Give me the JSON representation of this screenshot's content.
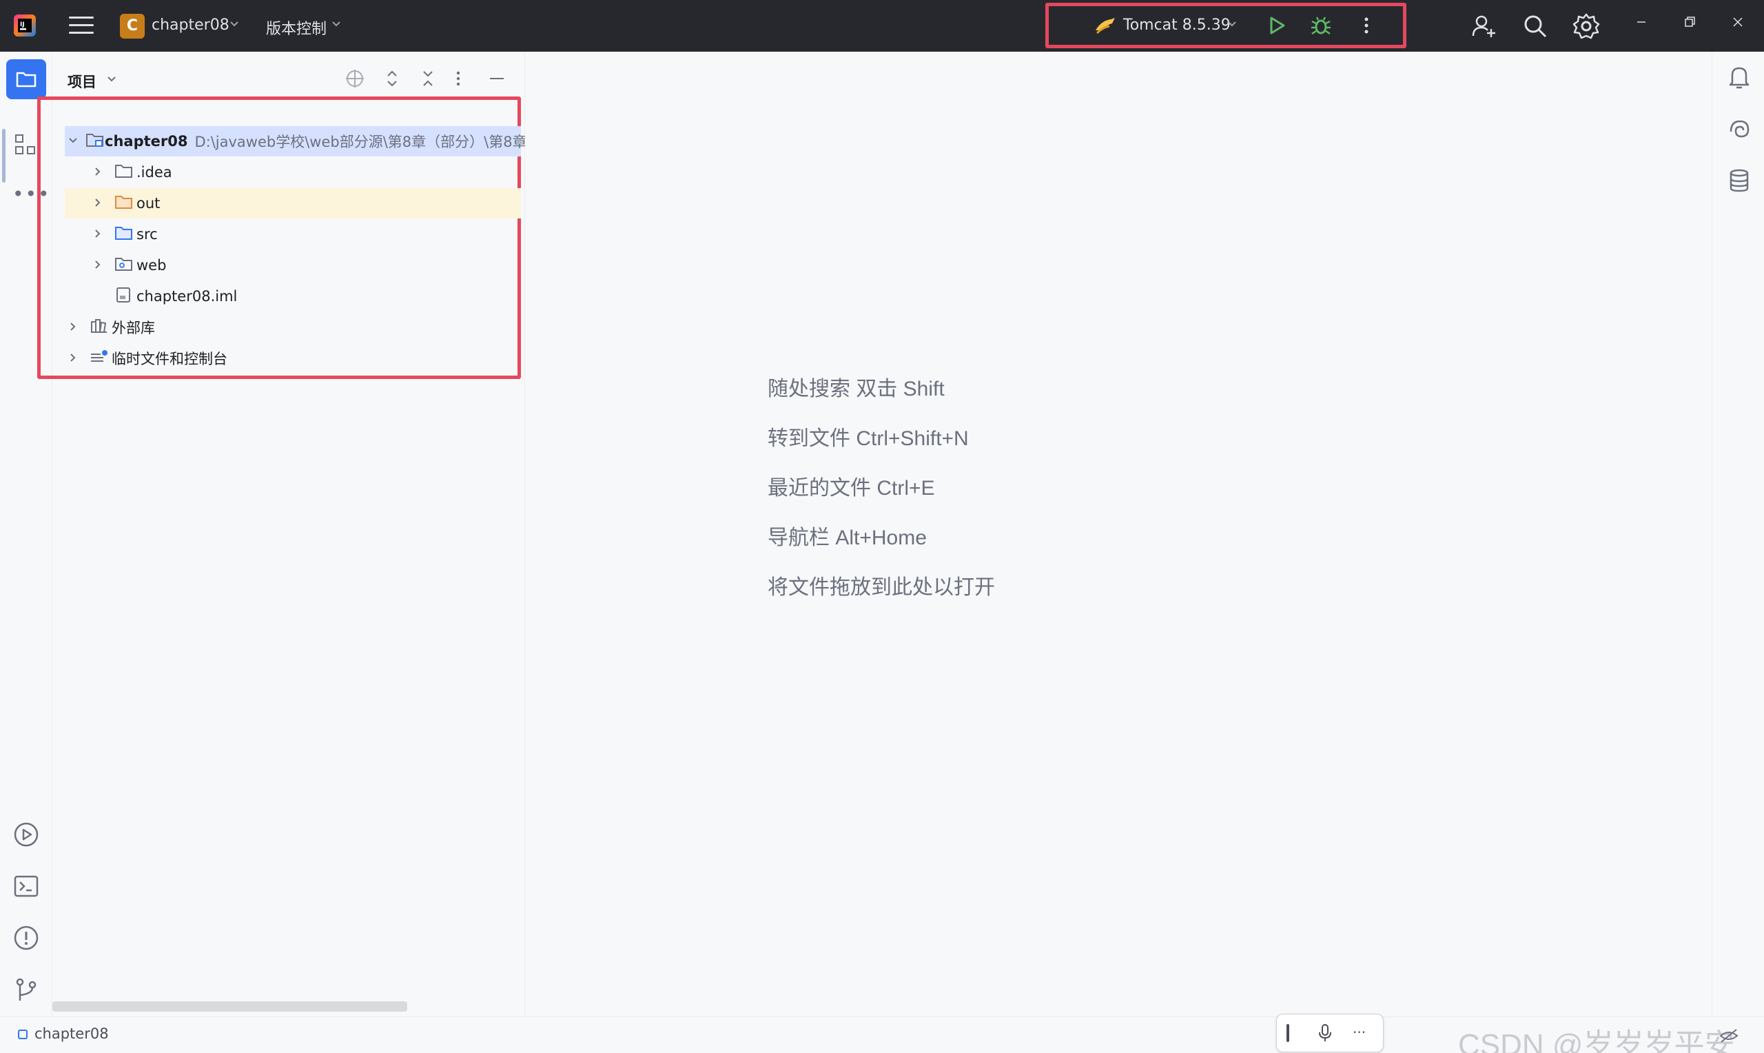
{
  "topbar": {
    "project_initial": "C",
    "project_name": "chapter08",
    "vcs_label": "版本控制",
    "run_config": "Tomcat 8.5.39"
  },
  "panel": {
    "title": "项目",
    "tree": [
      {
        "label": "chapter08",
        "path": "D:\\javaweb学校\\web部分源\\第8章（部分）\\第8章",
        "expanded": true,
        "selected": true
      },
      {
        "label": ".idea"
      },
      {
        "label": "out",
        "highlighted": true
      },
      {
        "label": "src"
      },
      {
        "label": "web"
      },
      {
        "label": "chapter08.iml"
      },
      {
        "label": "外部库"
      },
      {
        "label": "临时文件和控制台"
      }
    ]
  },
  "editor": {
    "hints": [
      "随处搜索 双击 Shift",
      "转到文件 Ctrl+Shift+N",
      "最近的文件 Ctrl+E",
      "导航栏 Alt+Home",
      "将文件拖放到此处以打开"
    ]
  },
  "statusbar": {
    "project": "chapter08",
    "watermark": "CSDN @岁岁岁平安"
  },
  "colors": {
    "accent": "#3574f0",
    "highlight_box": "#e5485e",
    "run_green": "#5fb865",
    "folder_orange": "#e08a3c"
  }
}
